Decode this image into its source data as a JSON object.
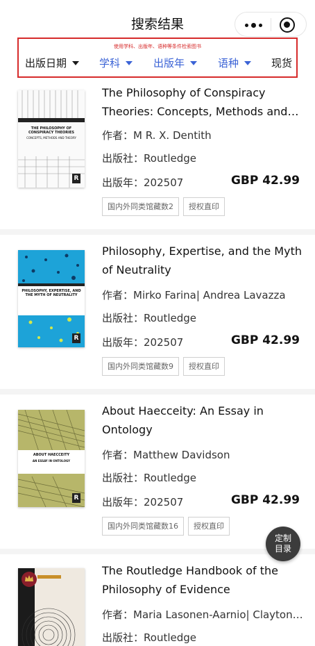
{
  "header": {
    "title": "搜索结果",
    "more_icon": "more-dots-icon",
    "target_icon": "target-icon"
  },
  "filter": {
    "hint": "使用学科、出版年、语种等条件检索图书",
    "items": [
      {
        "label": "出版日期",
        "color": "#1a1a1a"
      },
      {
        "label": "学科",
        "color": "#3b63d6"
      },
      {
        "label": "出版年",
        "color": "#3b63d6"
      },
      {
        "label": "语种",
        "color": "#3b63d6"
      },
      {
        "label": "现货",
        "color": "#1a1a1a"
      }
    ],
    "border_color": "#d62a2a"
  },
  "books": [
    {
      "title": "The Philosophy of Conspiracy Theories: Concepts, Methods and…",
      "author_label": "作者：",
      "author": "M R. X. Dentith",
      "publisher_label": "出版社：",
      "publisher": "Routledge",
      "year_label": "出版年：",
      "year": "202507",
      "price": "GBP 42.99",
      "tags": [
        "国内外同类馆藏数2",
        "授权直印"
      ],
      "cover_title": "THE PHILOSOPHY OF CONSPIRACY THEORIES",
      "cover_subtitle": "CONCEPTS, METHODS AND THEORY"
    },
    {
      "title": "Philosophy, Expertise, and the Myth of Neutrality",
      "author_label": "作者：",
      "author": "Mirko Farina| Andrea Lavazza",
      "publisher_label": "出版社：",
      "publisher": "Routledge",
      "year_label": "出版年：",
      "year": "202507",
      "price": "GBP 42.99",
      "tags": [
        "国内外同类馆藏数9",
        "授权直印"
      ],
      "cover_title": "PHILOSOPHY, EXPERTISE, AND THE MYTH OF NEUTRALITY",
      "cover_subtitle": ""
    },
    {
      "title": "About Haecceity: An Essay in Ontology",
      "author_label": "作者：",
      "author": "Matthew Davidson",
      "publisher_label": "出版社：",
      "publisher": "Routledge",
      "year_label": "出版年：",
      "year": "202507",
      "price": "GBP 42.99",
      "tags": [
        "国内外同类馆藏数16",
        "授权直印"
      ],
      "cover_title": "ABOUT HAECCEITY",
      "cover_subtitle": "AN ESSAY IN ONTOLOGY"
    },
    {
      "title": "The Routledge Handbook of the Philosophy of Evidence",
      "author_label": "作者：",
      "author": "Maria Lasonen-Aarnio| Clayton…",
      "publisher_label": "出版社：",
      "publisher": "Routledge",
      "year_label": "",
      "year": "",
      "price": "",
      "tags": [],
      "cover_title": "",
      "cover_subtitle": ""
    }
  ],
  "fab": {
    "line1": "定制",
    "line2": "目录"
  }
}
